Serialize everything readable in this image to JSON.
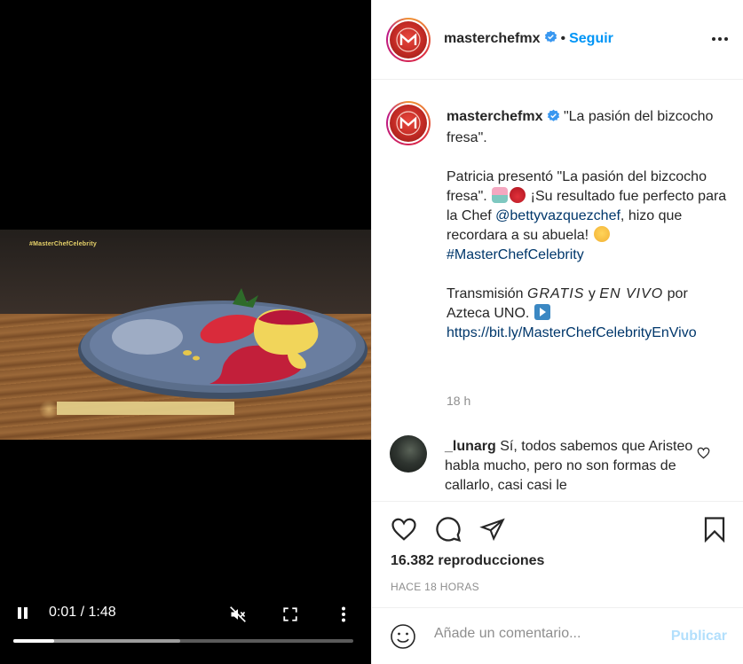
{
  "video": {
    "watermark": "#MasterChefCelebrity",
    "current_time": "0:01",
    "separator": "/",
    "duration": "1:48",
    "progress_played_fraction": 0.12,
    "progress_buffered_fraction": 0.49,
    "state": "playing",
    "muted": true,
    "icons": [
      "pause-icon",
      "mute-icon",
      "fullscreen-icon",
      "more-vertical-icon"
    ]
  },
  "header": {
    "username": "masterchefmx",
    "verified": true,
    "separator": "•",
    "follow_label": "Seguir"
  },
  "caption": {
    "username": "masterchefmx",
    "title": "\"La pasión del bizcocho fresa\".",
    "line1_start": "Patricia presentó \"La pasión del bizcocho fresa\".",
    "line1_end": "¡Su resultado fue perfecto para la Chef",
    "mention": "@bettyvazquezchef",
    "line2": ", hizo que recordara a su abuela!",
    "hashtag": "#MasterChefCelebrity",
    "broadcast_start": "Transmisión",
    "gratis": "GRATIS",
    "y": "y",
    "en_vivo": "EN VIVO",
    "broadcast_end": "por Azteca UNO.",
    "url": "https://bit.ly/MasterChefCelebrityEnVivo",
    "time": "18 h"
  },
  "comment": {
    "username": "_lunarg",
    "text": "Sí, todos sabemos que Aristeo habla mucho, pero no son formas de callarlo, casi casi le"
  },
  "actions": {
    "views": "16.382 reproducciones",
    "posted_ago": "HACE 18 HORAS"
  },
  "add_comment": {
    "placeholder": "Añade un comentario...",
    "post_label": "Publicar"
  },
  "colors": {
    "accent": "#0095f6",
    "link": "#00376b",
    "muted_text": "#8e8e8e",
    "post_disabled": "#b2dffc"
  }
}
